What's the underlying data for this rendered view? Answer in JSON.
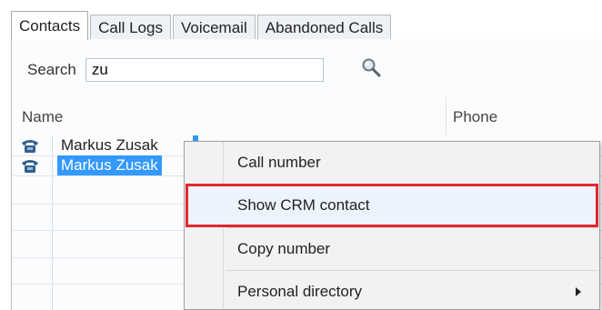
{
  "tabs": [
    {
      "label": "Contacts",
      "active": true
    },
    {
      "label": "Call Logs",
      "active": false
    },
    {
      "label": "Voicemail",
      "active": false
    },
    {
      "label": "Abandoned Calls",
      "active": false
    }
  ],
  "search": {
    "label": "Search",
    "value": "zu",
    "icon": "magnifier-icon"
  },
  "columns": {
    "name": "Name",
    "phone": "Phone"
  },
  "rows": [
    {
      "name": "Markus Zusak",
      "icon": "phone-icon",
      "selected": false
    },
    {
      "name": "Markus Zusak",
      "icon": "phone-icon",
      "selected": true
    }
  ],
  "context_menu": {
    "items": [
      {
        "label": "Call number"
      },
      {
        "label": "Show CRM contact",
        "highlighted": true
      },
      {
        "label": "Copy number"
      },
      {
        "label": "Personal directory",
        "submenu": true
      }
    ]
  },
  "colors": {
    "selection": "#3399ff",
    "annotation_box": "#e3262f",
    "menu_hover": "#e5eef9"
  }
}
